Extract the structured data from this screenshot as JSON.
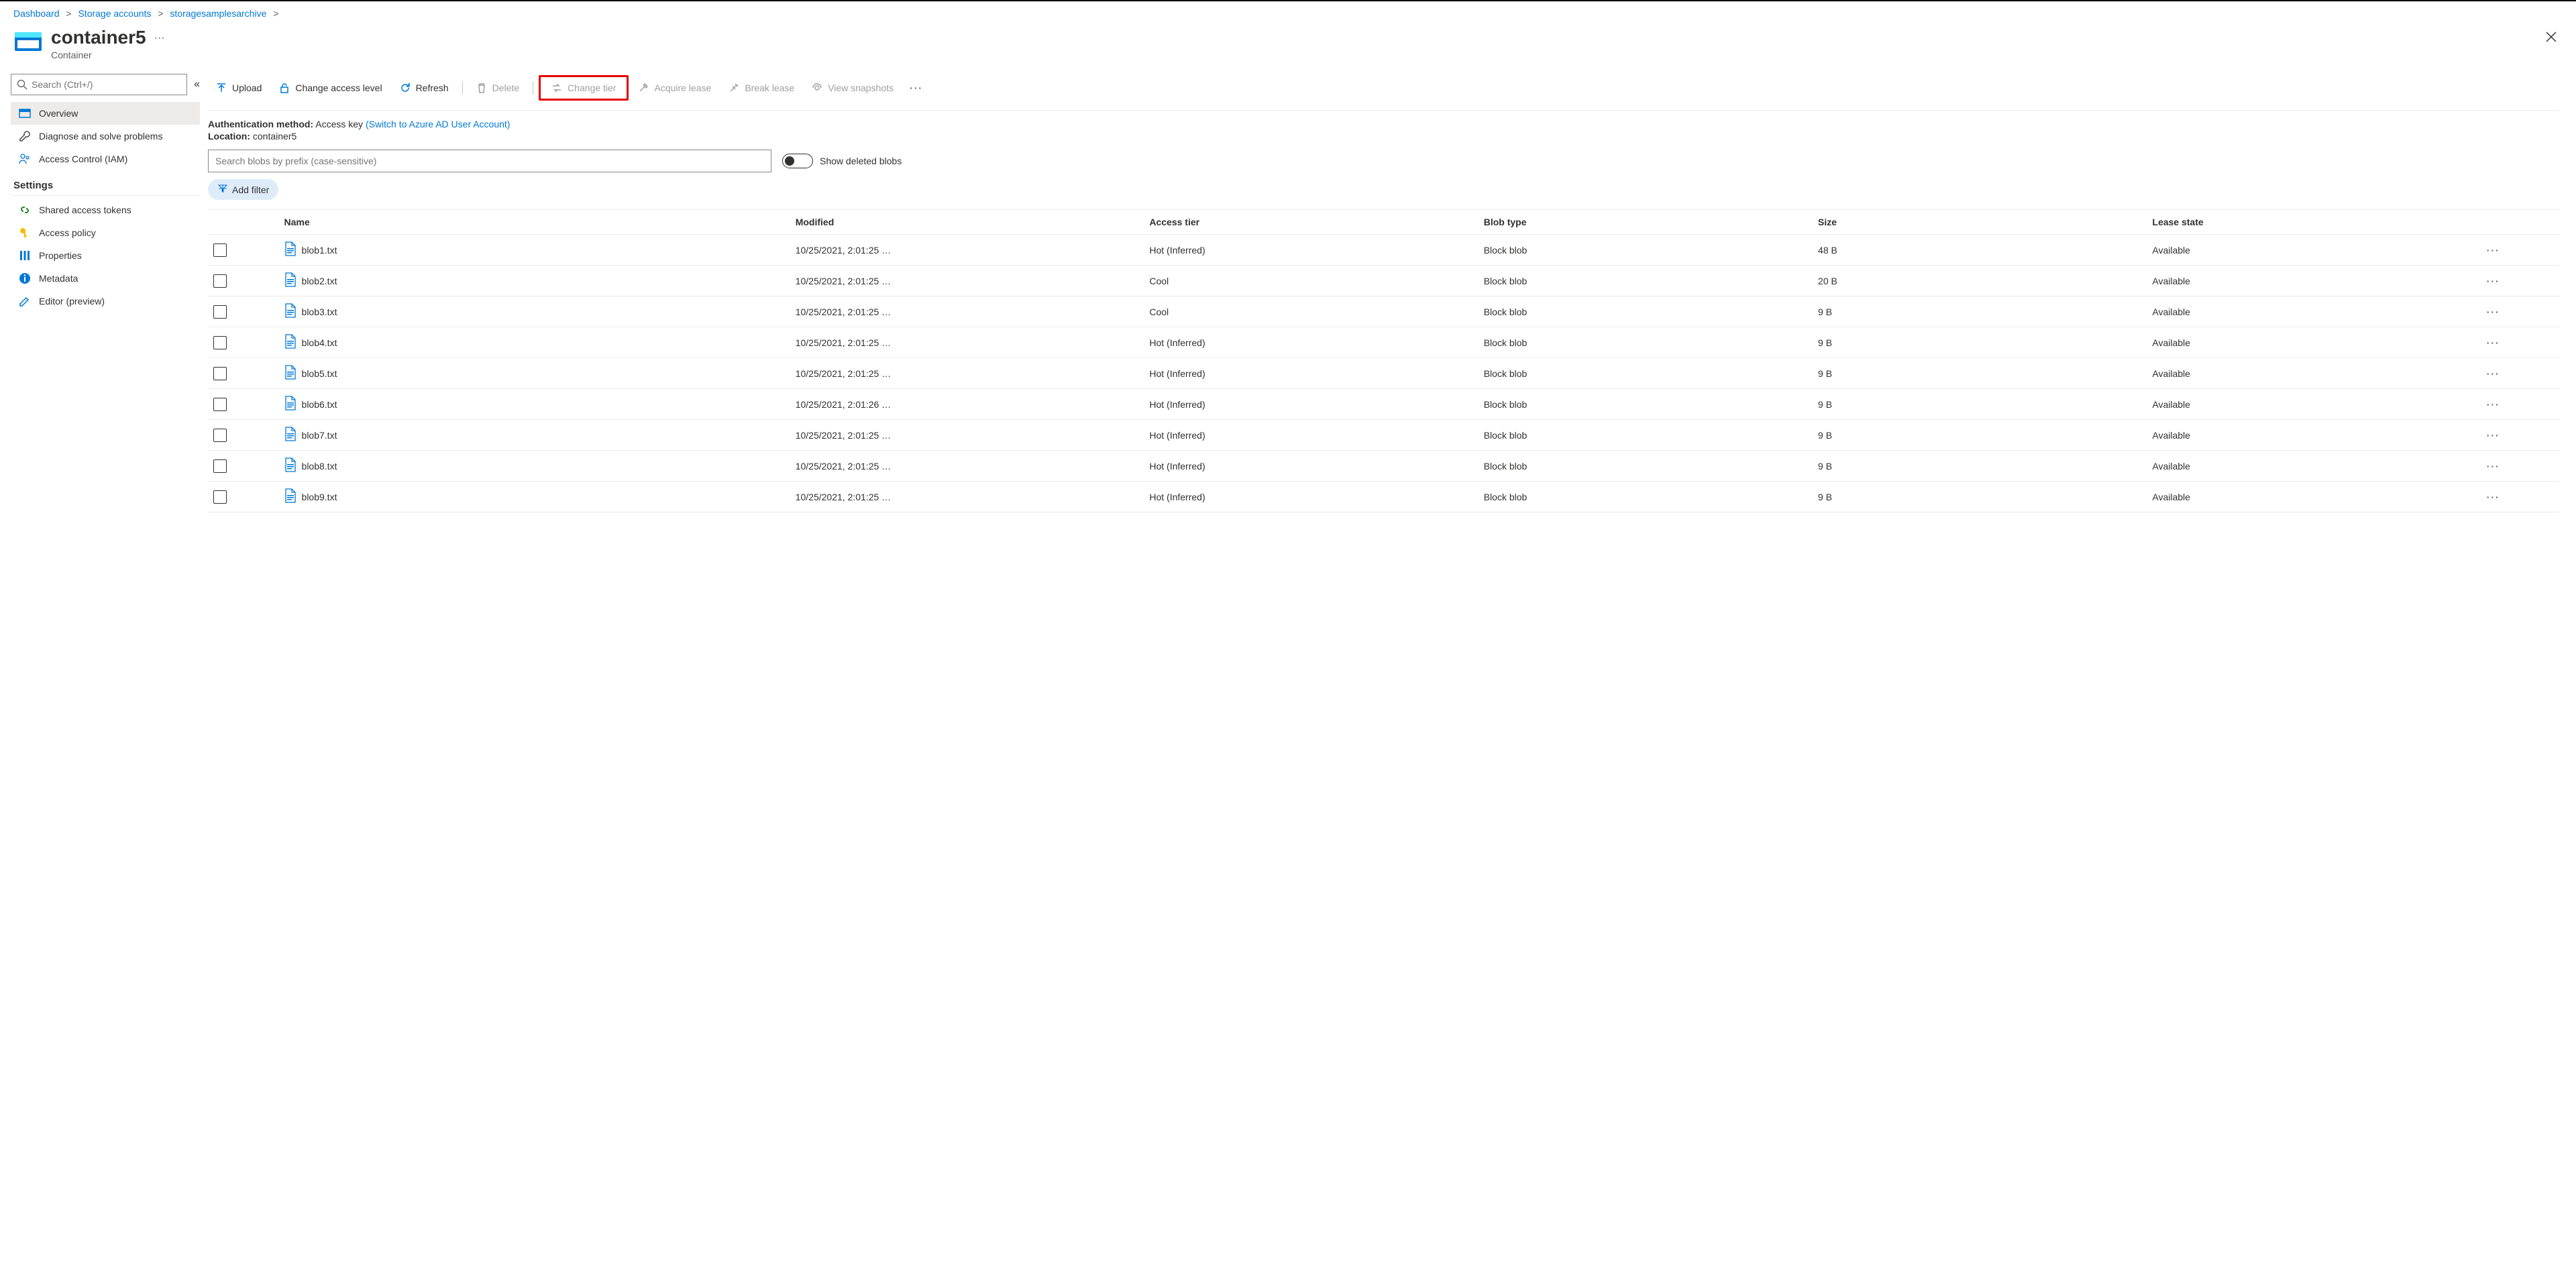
{
  "breadcrumbs": {
    "items": [
      {
        "label": "Dashboard"
      },
      {
        "label": "Storage accounts"
      },
      {
        "label": "storagesamplesarchive"
      }
    ],
    "sep": ">"
  },
  "header": {
    "title": "container5",
    "subtitle": "Container",
    "more": "···"
  },
  "sidebar": {
    "search_placeholder": "Search (Ctrl+/)",
    "items": [
      {
        "label": "Overview",
        "icon": "overview",
        "active": true
      },
      {
        "label": "Diagnose and solve problems",
        "icon": "wrench"
      },
      {
        "label": "Access Control (IAM)",
        "icon": "iam"
      }
    ],
    "settings_label": "Settings",
    "settings_items": [
      {
        "label": "Shared access tokens",
        "icon": "link",
        "color": "#107c10"
      },
      {
        "label": "Access policy",
        "icon": "key",
        "color": "#ffb900"
      },
      {
        "label": "Properties",
        "icon": "props",
        "color": "#0078d4"
      },
      {
        "label": "Metadata",
        "icon": "info",
        "color": "#0078d4"
      },
      {
        "label": "Editor (preview)",
        "icon": "edit",
        "color": "#0078d4"
      }
    ]
  },
  "toolbar": {
    "upload": "Upload",
    "change_access": "Change access level",
    "refresh": "Refresh",
    "delete": "Delete",
    "change_tier": "Change tier",
    "acquire_lease": "Acquire lease",
    "break_lease": "Break lease",
    "view_snapshots": "View snapshots"
  },
  "auth": {
    "label": "Authentication method:",
    "value": "Access key",
    "switch_link": "(Switch to Azure AD User Account)"
  },
  "location": {
    "label": "Location:",
    "value": "container5"
  },
  "blob_search_placeholder": "Search blobs by prefix (case-sensitive)",
  "toggle_label": "Show deleted blobs",
  "add_filter_label": "Add filter",
  "table": {
    "columns": {
      "name": "Name",
      "modified": "Modified",
      "tier": "Access tier",
      "type": "Blob type",
      "size": "Size",
      "lease": "Lease state"
    },
    "rows": [
      {
        "name": "blob1.txt",
        "modified": "10/25/2021, 2:01:25 …",
        "tier": "Hot (Inferred)",
        "type": "Block blob",
        "size": "48 B",
        "lease": "Available"
      },
      {
        "name": "blob2.txt",
        "modified": "10/25/2021, 2:01:25 …",
        "tier": "Cool",
        "type": "Block blob",
        "size": "20 B",
        "lease": "Available"
      },
      {
        "name": "blob3.txt",
        "modified": "10/25/2021, 2:01:25 …",
        "tier": "Cool",
        "type": "Block blob",
        "size": "9 B",
        "lease": "Available"
      },
      {
        "name": "blob4.txt",
        "modified": "10/25/2021, 2:01:25 …",
        "tier": "Hot (Inferred)",
        "type": "Block blob",
        "size": "9 B",
        "lease": "Available"
      },
      {
        "name": "blob5.txt",
        "modified": "10/25/2021, 2:01:25 …",
        "tier": "Hot (Inferred)",
        "type": "Block blob",
        "size": "9 B",
        "lease": "Available"
      },
      {
        "name": "blob6.txt",
        "modified": "10/25/2021, 2:01:26 …",
        "tier": "Hot (Inferred)",
        "type": "Block blob",
        "size": "9 B",
        "lease": "Available"
      },
      {
        "name": "blob7.txt",
        "modified": "10/25/2021, 2:01:25 …",
        "tier": "Hot (Inferred)",
        "type": "Block blob",
        "size": "9 B",
        "lease": "Available"
      },
      {
        "name": "blob8.txt",
        "modified": "10/25/2021, 2:01:25 …",
        "tier": "Hot (Inferred)",
        "type": "Block blob",
        "size": "9 B",
        "lease": "Available"
      },
      {
        "name": "blob9.txt",
        "modified": "10/25/2021, 2:01:25 …",
        "tier": "Hot (Inferred)",
        "type": "Block blob",
        "size": "9 B",
        "lease": "Available"
      }
    ]
  }
}
